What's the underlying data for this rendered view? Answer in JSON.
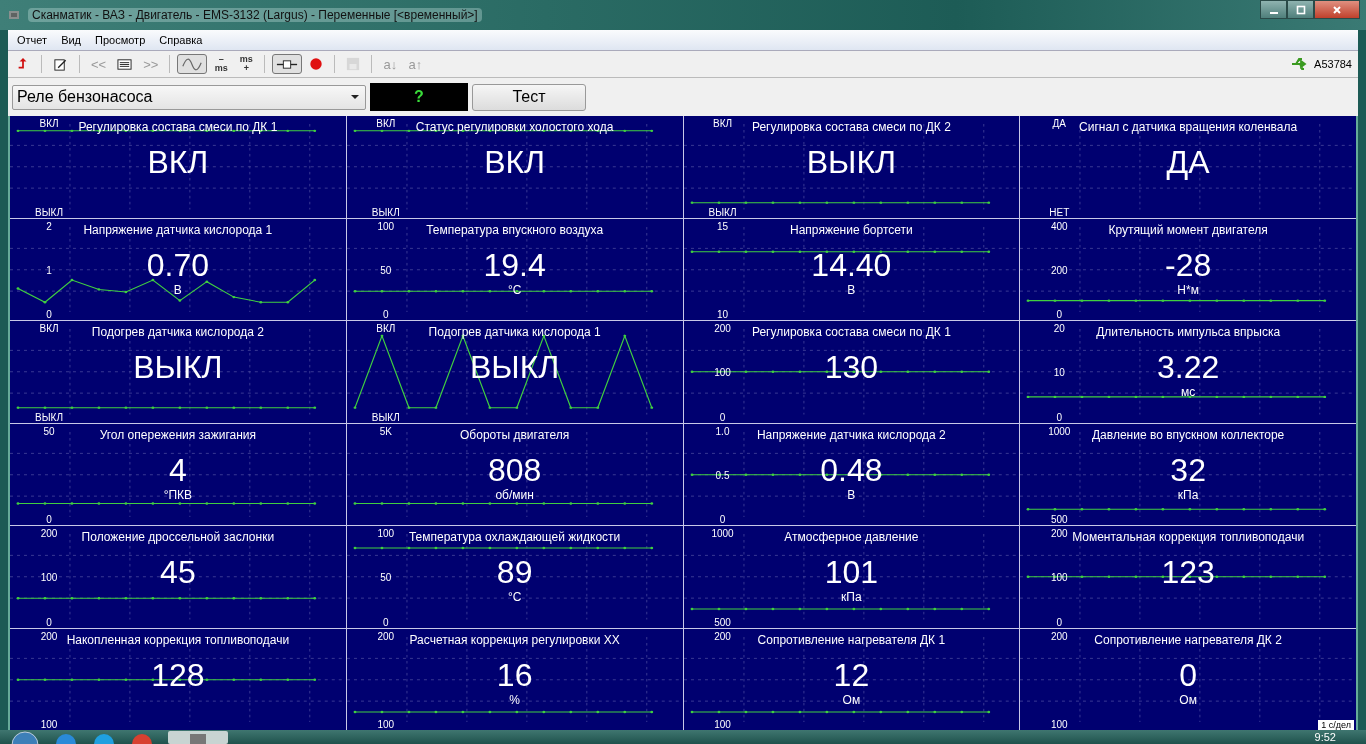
{
  "window": {
    "title": "Сканматик - ВАЗ - Двигатель - EMS-3132 (Largus) - Переменные [<временный>]"
  },
  "menu": [
    "Отчет",
    "Вид",
    "Просмотр",
    "Справка"
  ],
  "toolbar": [
    {
      "kind": "back",
      "selected": false,
      "disabled": false
    },
    {
      "kind": "sep"
    },
    {
      "kind": "edit",
      "selected": false,
      "disabled": false
    },
    {
      "kind": "sep"
    },
    {
      "kind": "text",
      "label": "<<",
      "selected": false,
      "disabled": true
    },
    {
      "kind": "list",
      "selected": false,
      "disabled": false
    },
    {
      "kind": "text",
      "label": ">>",
      "selected": false,
      "disabled": true
    },
    {
      "kind": "sep"
    },
    {
      "kind": "wave",
      "selected": true,
      "disabled": false
    },
    {
      "kind": "stack",
      "top": "–",
      "bottom": "ms",
      "selected": false,
      "disabled": false
    },
    {
      "kind": "stack",
      "top": "ms",
      "bottom": "+",
      "selected": false,
      "disabled": false
    },
    {
      "kind": "sep"
    },
    {
      "kind": "plug",
      "selected": true,
      "disabled": false
    },
    {
      "kind": "record",
      "selected": false,
      "disabled": false
    },
    {
      "kind": "sep"
    },
    {
      "kind": "save",
      "selected": false,
      "disabled": true
    },
    {
      "kind": "sep"
    },
    {
      "kind": "text",
      "label": "a↓",
      "selected": false,
      "disabled": true
    },
    {
      "kind": "text",
      "label": "a↑",
      "selected": false,
      "disabled": true
    }
  ],
  "device": "A53784",
  "selector": {
    "value": "Реле бензонасоса",
    "indicator": "?",
    "button": "Тест"
  },
  "tiles": [
    {
      "title": "Регулировка состава смеси по ДК 1",
      "value": "ВКЛ",
      "ticks": [
        "ВКЛ",
        "ВЫКЛ"
      ]
    },
    {
      "title": "Статус регулировки холостого хода",
      "value": "ВКЛ",
      "ticks": [
        "ВКЛ",
        "ВЫКЛ"
      ]
    },
    {
      "title": "Регулировка состава смеси по ДК 2",
      "value": "ВЫКЛ",
      "ticks": [
        "ВКЛ",
        "ВЫКЛ"
      ]
    },
    {
      "title": "Сигнал с датчика вращения коленвала",
      "value": "ДА",
      "ticks": [
        "ДА",
        "НЕТ"
      ]
    },
    {
      "title": "Напряжение датчика кислорода 1",
      "value": "0.70",
      "unit": "В",
      "ticks": [
        "2",
        "1",
        "0"
      ]
    },
    {
      "title": "Температура впускного воздуха",
      "value": "19.4",
      "unit": "°C",
      "ticks": [
        "100",
        "50",
        "0"
      ]
    },
    {
      "title": "Напряжение бортсети",
      "value": "14.40",
      "unit": "В",
      "ticks": [
        "15",
        "10"
      ]
    },
    {
      "title": "Крутящий момент двигателя",
      "value": "-28",
      "unit": "Н*м",
      "ticks": [
        "400",
        "200",
        "0"
      ]
    },
    {
      "title": "Подогрев датчика кислорода 2",
      "value": "ВЫКЛ",
      "ticks": [
        "ВКЛ",
        "ВЫКЛ"
      ]
    },
    {
      "title": "Подогрев датчика кислорода 1",
      "value": "ВЫКЛ",
      "ticks": [
        "ВКЛ",
        "ВЫКЛ"
      ]
    },
    {
      "title": "Регулировка состава смеси по ДК 1",
      "value": "130",
      "ticks": [
        "200",
        "100",
        "0"
      ]
    },
    {
      "title": "Длительность импульса впрыска",
      "value": "3.22",
      "unit": "мс",
      "ticks": [
        "20",
        "10",
        "0"
      ]
    },
    {
      "title": "Угол опережения зажигания",
      "value": "4",
      "unit": "°ПКВ",
      "ticks": [
        "50",
        "0"
      ]
    },
    {
      "title": "Обороты двигателя",
      "value": "808",
      "unit": "об/мин",
      "ticks": [
        "5K"
      ]
    },
    {
      "title": "Напряжение датчика кислорода 2",
      "value": "0.48",
      "unit": "В",
      "ticks": [
        "1.0",
        "0.5",
        "0"
      ]
    },
    {
      "title": "Давление во впускном коллекторе",
      "value": "32",
      "unit": "кПа",
      "ticks": [
        "1000",
        "500"
      ]
    },
    {
      "title": "Положение дроссельной заслонки",
      "value": "45",
      "ticks": [
        "200",
        "100",
        "0"
      ]
    },
    {
      "title": "Температура охлаждающей жидкости",
      "value": "89",
      "unit": "°C",
      "ticks": [
        "100",
        "50",
        "0"
      ]
    },
    {
      "title": "Атмосферное давление",
      "value": "101",
      "unit": "кПа",
      "ticks": [
        "1000",
        "500"
      ]
    },
    {
      "title": "Моментальная коррекция топливоподачи",
      "value": "123",
      "ticks": [
        "200",
        "100",
        "0"
      ]
    },
    {
      "title": "Накопленная коррекция топливоподачи",
      "value": "128",
      "ticks": [
        "200",
        "100"
      ]
    },
    {
      "title": "Расчетная коррекция регулировки XX",
      "value": "16",
      "unit": "%",
      "ticks": [
        "200",
        "100"
      ]
    },
    {
      "title": "Сопротивление нагревателя ДК 1",
      "value": "12",
      "unit": "Ом",
      "ticks": [
        "200",
        "100"
      ]
    },
    {
      "title": "Сопротивление нагревателя ДК 2",
      "value": "0",
      "unit": "Ом",
      "ticks": [
        "200",
        "100"
      ]
    }
  ],
  "scale_label": "1 с/дел",
  "taskbar": {
    "clock": "9:52"
  }
}
